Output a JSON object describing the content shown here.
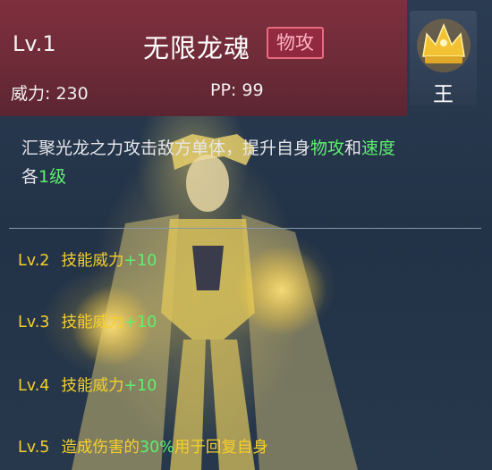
{
  "skill": {
    "level": "Lv.1",
    "name": "无限龙魂",
    "type_badge": "物攻",
    "power_label": "威力",
    "power_value": "230",
    "pp_label": "PP",
    "pp_value": "99",
    "rank_label": "王"
  },
  "description": {
    "part1": "汇聚光龙之力攻击敌方单体，提升自身",
    "highlight1": "物攻",
    "part2": "和",
    "highlight2": "速度",
    "part3": "各",
    "highlight3": "1级"
  },
  "upgrades": [
    {
      "level": "Lv.2",
      "text": "技能威力",
      "bonus": "+10"
    },
    {
      "level": "Lv.3",
      "text": "技能威力",
      "bonus": "+10"
    },
    {
      "level": "Lv.4",
      "text": "技能威力",
      "bonus": "+10"
    },
    {
      "level": "Lv.5",
      "text": "造成伤害的",
      "bonus": "30%",
      "text_after": "用于回复自身"
    }
  ],
  "colors": {
    "header_bg": "#6e2b38",
    "badge_border": "#e86b7e",
    "highlight_green": "#5ef06f",
    "upgrade_yellow": "#f5cf2a",
    "rank_gold": "#f2c232"
  },
  "icons": {
    "rank": "crown-icon"
  }
}
